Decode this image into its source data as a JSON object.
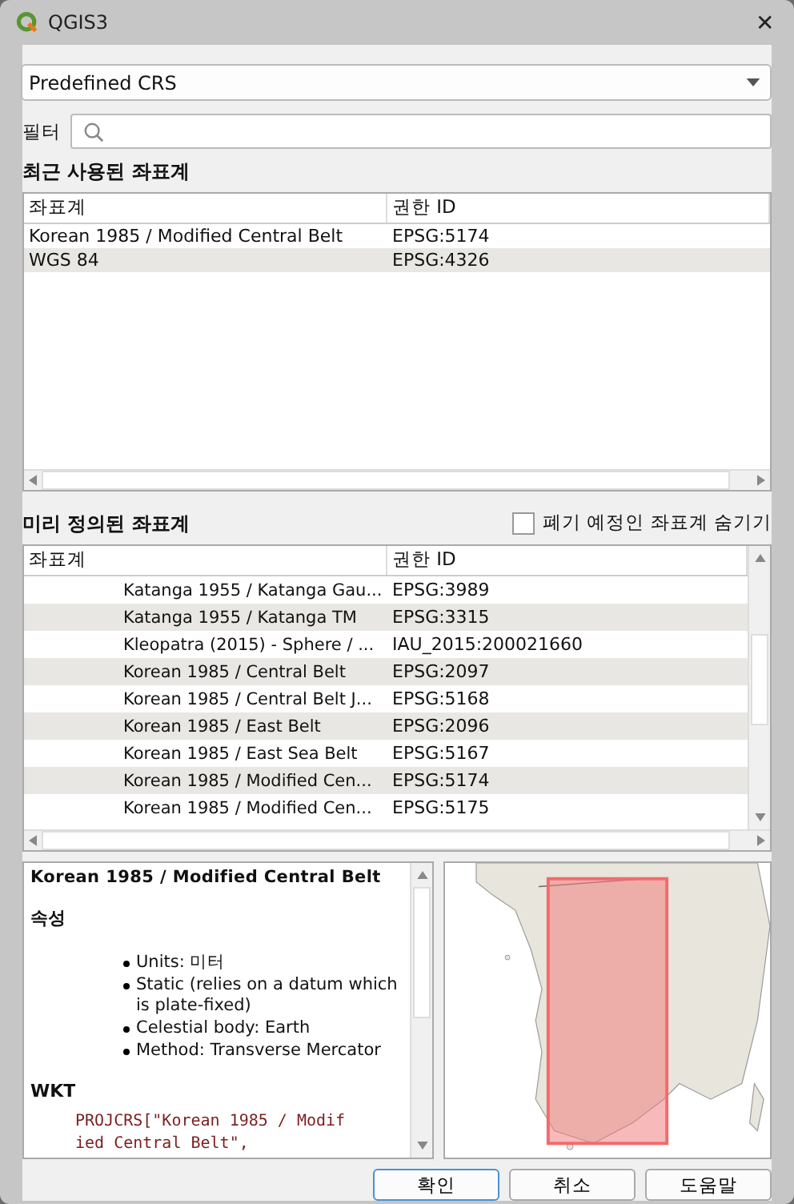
{
  "window": {
    "title": "QGIS3",
    "close": "✕"
  },
  "crs_type": {
    "value": "Predefined CRS"
  },
  "filter": {
    "label": "필터"
  },
  "recent": {
    "heading": "최근 사용된 좌표계",
    "columns": [
      "좌표계",
      "권한 ID"
    ],
    "rows": [
      {
        "name": "Korean 1985 / Modified Central Belt",
        "id": "EPSG:5174"
      },
      {
        "name": "WGS 84",
        "id": "EPSG:4326"
      }
    ]
  },
  "predefined": {
    "heading": "미리 정의된 좌표계",
    "hide_deprecated": {
      "label": "폐기 예정인 좌표계 숨기기",
      "checked": false
    },
    "columns": [
      "좌표계",
      "권한 ID"
    ],
    "rows": [
      {
        "name": "Katanga 1955 / Katanga Gau...",
        "id": "EPSG:3989"
      },
      {
        "name": "Katanga 1955 / Katanga TM",
        "id": "EPSG:3315"
      },
      {
        "name": "Kleopatra (2015) - Sphere / ...",
        "id": "IAU_2015:200021660"
      },
      {
        "name": "Korean 1985 / Central Belt",
        "id": "EPSG:2097"
      },
      {
        "name": "Korean 1985 / Central Belt J...",
        "id": "EPSG:5168"
      },
      {
        "name": "Korean 1985 / East Belt",
        "id": "EPSG:2096"
      },
      {
        "name": "Korean 1985 / East Sea Belt",
        "id": "EPSG:5167"
      },
      {
        "name": "Korean 1985 / Modified Cen...",
        "id": "EPSG:5174"
      },
      {
        "name": "Korean 1985 / Modified Cen...",
        "id": "EPSG:5175"
      }
    ]
  },
  "details": {
    "title": "Korean 1985 / Modified Central Belt",
    "properties_heading": "속성",
    "properties": [
      "Units: 미터",
      "Static (relies on a datum which is plate-fixed)",
      "Celestial body: Earth",
      "Method: Transverse Mercator"
    ],
    "wkt_heading": "WKT",
    "wkt_lines": [
      "PROJCRS[\"Korean 1985 / Modif",
      "ied Central Belt\","
    ]
  },
  "map": {
    "kind": "picture"
  },
  "buttons": [
    "확인",
    "취소",
    "도움말"
  ]
}
